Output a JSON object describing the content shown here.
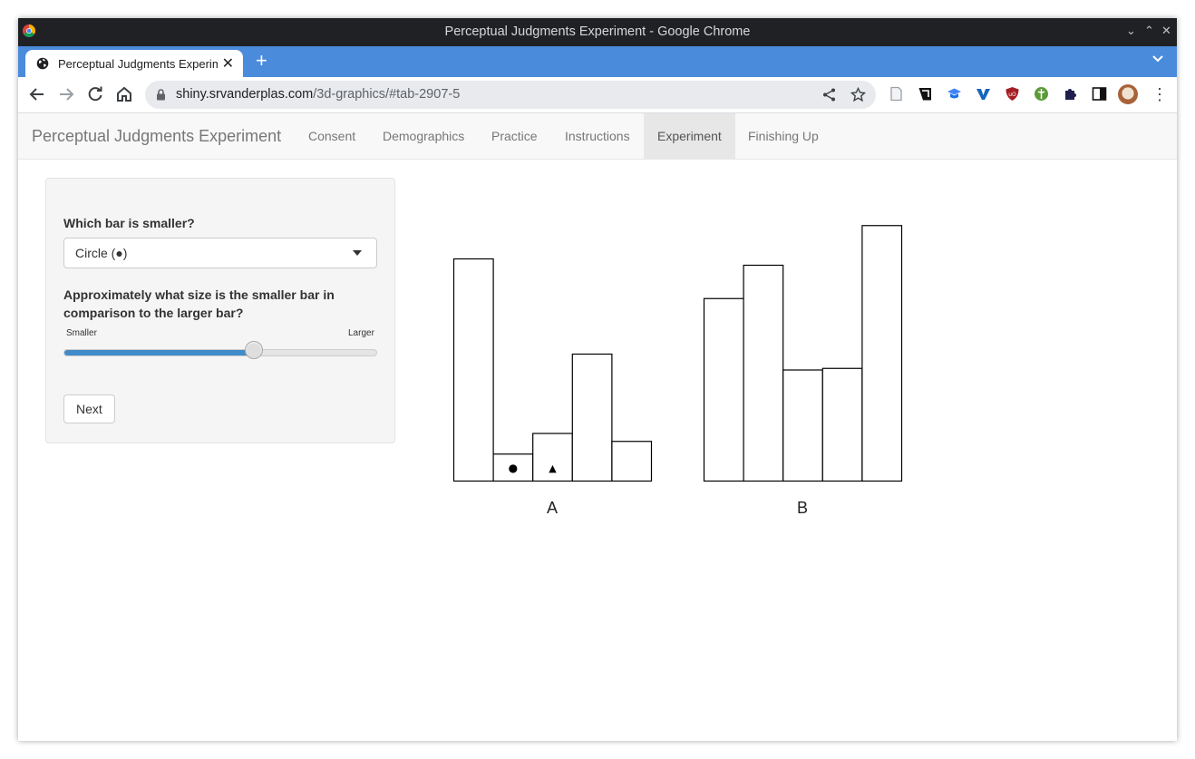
{
  "window": {
    "title": "Perceptual Judgments Experiment - Google Chrome",
    "controls": [
      "⌄",
      "⌃",
      "✕"
    ]
  },
  "tab": {
    "title": "Perceptual Judgments Experiment",
    "close": "✕",
    "new_tab": "+"
  },
  "omnibox": {
    "url_host": "shiny.srvanderplas.com",
    "url_path": "/3d-graphics/#tab-2907-5"
  },
  "app": {
    "brand": "Perceptual Judgments Experiment",
    "nav": [
      {
        "label": "Consent",
        "active": false
      },
      {
        "label": "Demographics",
        "active": false
      },
      {
        "label": "Practice",
        "active": false
      },
      {
        "label": "Instructions",
        "active": false
      },
      {
        "label": "Experiment",
        "active": true
      },
      {
        "label": "Finishing Up",
        "active": false
      }
    ]
  },
  "form": {
    "q1_label": "Which bar is smaller?",
    "q1_value": "Circle (●)",
    "q2_label": "Approximately what size is the smaller bar in comparison to the larger bar?",
    "slider_min_label": "Smaller",
    "slider_max_label": "Larger",
    "slider_value_fraction": 0.61,
    "next_label": "Next"
  },
  "colors": {
    "browser_tab_strip": "#4a8bdb",
    "slider_fill": "#428bca",
    "navbar_bg": "#f8f8f8",
    "panel_bg": "#f5f5f5"
  },
  "chart_data": [
    {
      "type": "bar",
      "label": "A",
      "values": [
        70,
        8.5,
        15,
        40,
        12.5
      ],
      "markers": [
        null,
        "●",
        "▲",
        null,
        null
      ],
      "ylim": [
        0,
        80
      ]
    },
    {
      "type": "bar",
      "label": "B",
      "values": [
        57.5,
        68,
        35,
        35.5,
        80.5
      ],
      "ylim": [
        0,
        80
      ]
    }
  ]
}
